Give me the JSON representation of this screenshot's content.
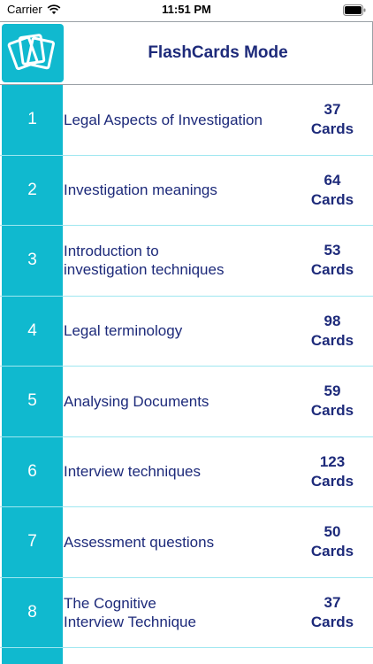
{
  "status_bar": {
    "carrier": "Carrier",
    "time": "11:51 PM"
  },
  "header": {
    "title": "FlashCards Mode"
  },
  "decks": [
    {
      "number": "1",
      "title": "Legal Aspects of Investigation",
      "count": "37",
      "unit": "Cards"
    },
    {
      "number": "2",
      "title": "Investigation meanings",
      "count": "64",
      "unit": "Cards"
    },
    {
      "number": "3",
      "title": "Introduction to\ninvestigation techniques",
      "count": "53",
      "unit": "Cards"
    },
    {
      "number": "4",
      "title": "Legal terminology",
      "count": "98",
      "unit": "Cards"
    },
    {
      "number": "5",
      "title": "Analysing Documents",
      "count": "59",
      "unit": "Cards"
    },
    {
      "number": "6",
      "title": "Interview techniques",
      "count": "123",
      "unit": "Cards"
    },
    {
      "number": "7",
      "title": "Assessment questions",
      "count": "50",
      "unit": "Cards"
    },
    {
      "number": "8",
      "title": "The Cognitive\nInterview Technique",
      "count": "37",
      "unit": "Cards"
    }
  ],
  "colors": {
    "accent": "#10b9cf",
    "text": "#1d2a7a",
    "divider": "#9fe7f0"
  }
}
